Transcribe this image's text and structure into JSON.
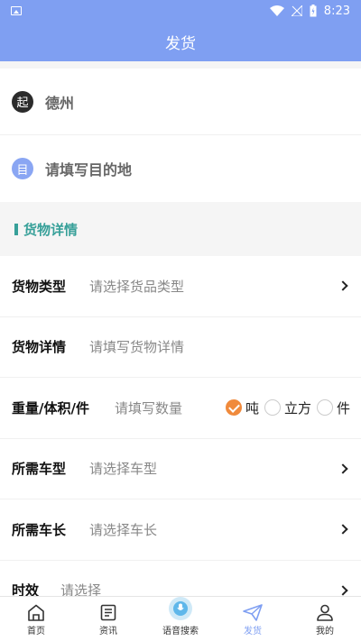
{
  "status": {
    "time": "8:23"
  },
  "header": {
    "title": "发货"
  },
  "addresses": {
    "start_badge": "起",
    "start_value": "德州",
    "end_badge": "目",
    "end_placeholder": "请填写目的地"
  },
  "section": {
    "title": "货物详情"
  },
  "form": {
    "cargo_type": {
      "label": "货物类型",
      "placeholder": "请选择货品类型"
    },
    "cargo_detail": {
      "label": "货物详情",
      "placeholder": "请填写货物详情"
    },
    "weight": {
      "label": "重量/体积/件",
      "placeholder": "请填写数量",
      "units": [
        {
          "label": "吨",
          "checked": true
        },
        {
          "label": "立方",
          "checked": false
        },
        {
          "label": "件",
          "checked": false
        }
      ]
    },
    "truck_type": {
      "label": "所需车型",
      "placeholder": "请选择车型"
    },
    "truck_length": {
      "label": "所需车长",
      "placeholder": "请选择车长"
    },
    "timeliness": {
      "label": "时效",
      "placeholder": "请选择"
    }
  },
  "tabbar": {
    "items": [
      {
        "label": "首页",
        "icon": "home-icon"
      },
      {
        "label": "资讯",
        "icon": "news-icon"
      },
      {
        "label": "语音搜索",
        "icon": "microphone-icon"
      },
      {
        "label": "发货",
        "icon": "paper-plane-icon",
        "active": true
      },
      {
        "label": "我的",
        "icon": "user-icon"
      }
    ]
  },
  "colors": {
    "primary": "#7f9ff2",
    "accent": "#37a099",
    "checked": "#f08a3c"
  }
}
